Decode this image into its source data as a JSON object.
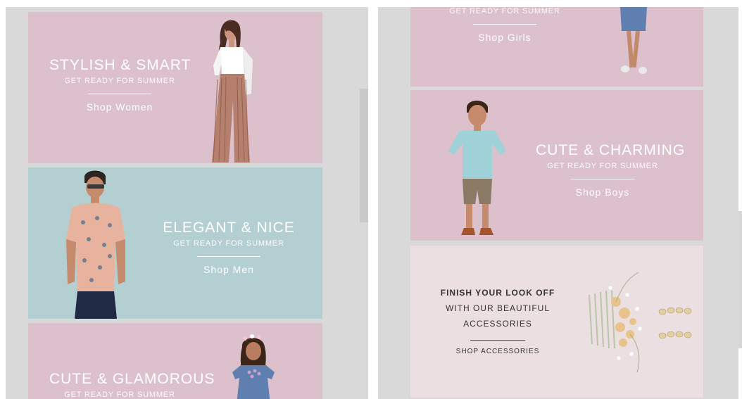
{
  "left_panel": {
    "banners": [
      {
        "title": "STYLISH & SMART",
        "subtitle": "GET READY FOR SUMMER",
        "link": "Shop Women"
      },
      {
        "title": "ELEGANT & NICE",
        "subtitle": "GET READY FOR SUMMER",
        "link": "Shop Men"
      },
      {
        "title": "CUTE & GLAMOROUS",
        "subtitle": "GET READY FOR SUMMER",
        "link": ""
      }
    ]
  },
  "right_panel": {
    "banners": [
      {
        "title": "",
        "subtitle": "GET READY FOR SUMMER",
        "link": "Shop Girls"
      },
      {
        "title": "CUTE & CHARMING",
        "subtitle": "GET READY FOR SUMMER",
        "link": "Shop Boys"
      }
    ],
    "accessories": {
      "line1": "FINISH YOUR LOOK OFF",
      "line2": "WITH OUR BEAUTIFUL",
      "line3": "ACCESSORIES",
      "link": "SHOP ACCESSORIES"
    }
  },
  "colors": {
    "pink": "#dcc0cc",
    "blue": "#b4cfd1",
    "cream": "#ecdfe2",
    "frame": "#d9d9d9"
  },
  "icons": [
    "model-woman-image",
    "model-man-image",
    "model-girl-image",
    "model-boy-image",
    "hair-comb-image",
    "earrings-image"
  ]
}
